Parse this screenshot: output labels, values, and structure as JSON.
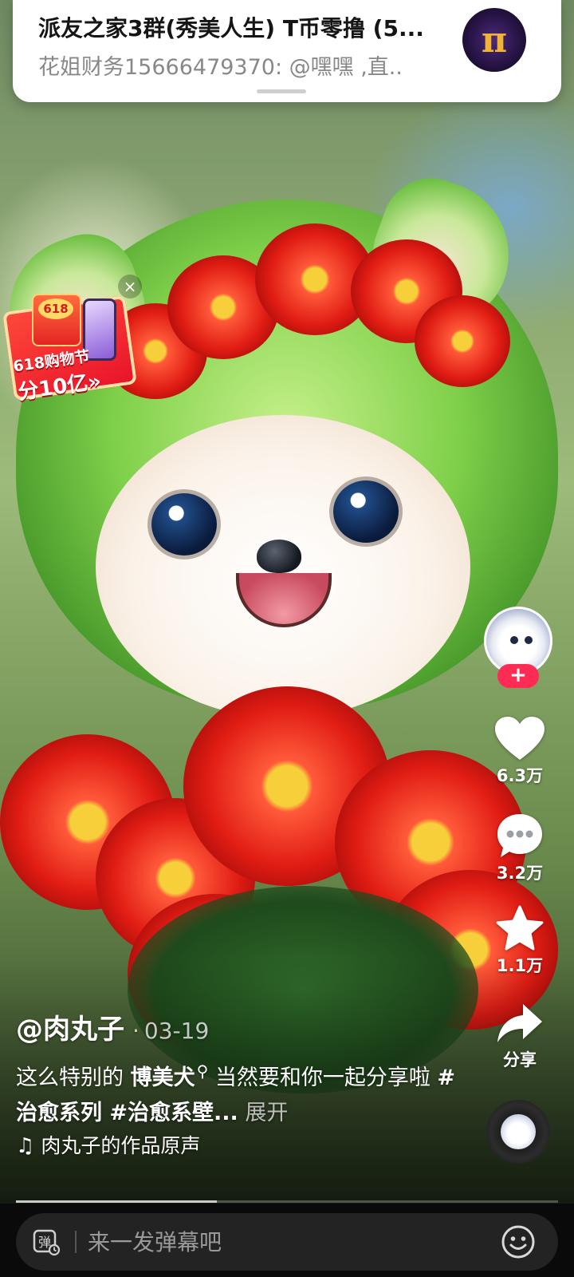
{
  "notification": {
    "title": "派友之家3群(秀美人生) T币零撸 (5...",
    "message": "花姐财务15666479370: @嘿嘿 ,直..",
    "avatar_icon": "pi-logo",
    "avatar_glyph": "π"
  },
  "promo": {
    "badge": "618",
    "line1": "618购物节",
    "line2": "分10亿»",
    "close_glyph": "×"
  },
  "author": {
    "handle": "@肉丸子",
    "separator": "·",
    "date": "03-19",
    "follow_glyph": "+"
  },
  "actions": {
    "like_count": "6.3万",
    "comment_count": "3.2万",
    "favorite_count": "1.1万",
    "share_label": "分享"
  },
  "caption": {
    "text_before": "这么特别的 ",
    "keyword": "博美犬",
    "text_after": " 当然要和你一起分享啦 ",
    "hashtags": "#治愈系列 #治愈系壁...",
    "expand": " 展开"
  },
  "music": {
    "note_glyph": "♫",
    "title": "肉丸子的作品原声"
  },
  "progress": {
    "fraction": 0.37
  },
  "danmu": {
    "placeholder": "来一发弹幕吧",
    "icon": "danmu-icon",
    "emoji_icon": "emoji-icon"
  },
  "colors": {
    "accent": "#fe2c55",
    "bottom_bar": "#0a0a0a",
    "input_bg": "#232323"
  }
}
